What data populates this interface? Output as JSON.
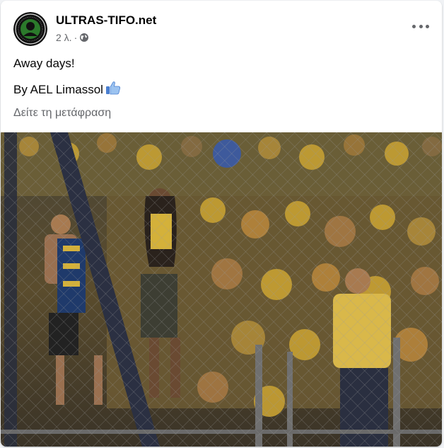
{
  "post": {
    "page_name": "ULTRAS-TIFO.net",
    "time": "2 λ.",
    "separator": "·",
    "privacy_icon": "globe-icon",
    "more_icon": "more-options-icon",
    "text_line1": "Away days!",
    "text_line2": "By AEL Limassol",
    "thumbs_emoji_icon": "thumbs-up-emoji-icon",
    "translate_link": "Δείτε τη μετάφραση",
    "image_icon": "photo-fans-behind-fence"
  },
  "colors": {
    "name_text": "#050505",
    "secondary_text": "#65676b",
    "card_bg": "#ffffff",
    "page_bg": "#f0f2f5",
    "photo_yellow": "#c9a233",
    "photo_blue": "#1f3a6b"
  }
}
